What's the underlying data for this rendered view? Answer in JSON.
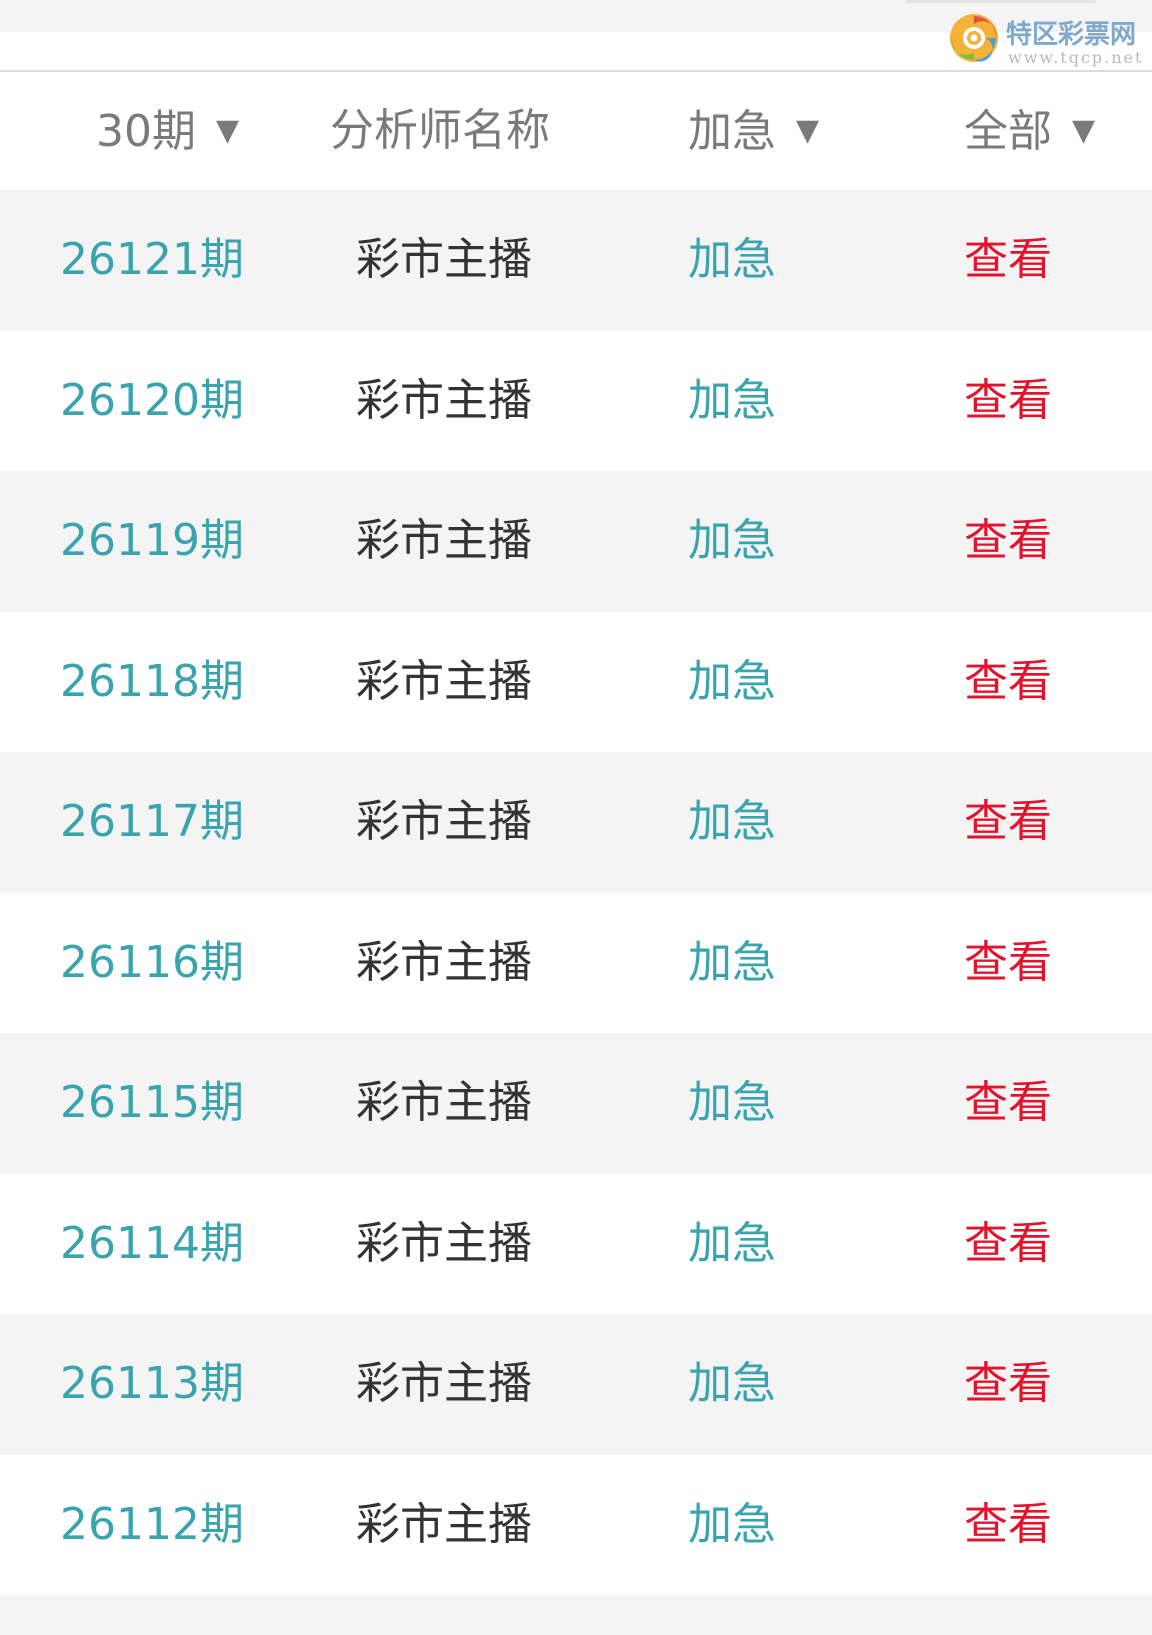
{
  "logo": {
    "name": "特区彩票网",
    "url": "www.tqcp.net",
    "icon": "swirl-logo-icon"
  },
  "header": {
    "period_filter": "30期",
    "analyst_name": "分析师名称",
    "urgent_filter": "加急",
    "type_filter": "全部",
    "dropdown_glyph": "▼"
  },
  "colors": {
    "issue": "#3aa4ae",
    "urgent": "#3aa4ae",
    "view": "#e2142d",
    "name": "#333333",
    "header_text": "#7a7a7a",
    "row_alt_bg": "#f4f4f4"
  },
  "rows": [
    {
      "issue": "26121期",
      "analyst": "彩市主播",
      "urgent": "加急",
      "action": "查看"
    },
    {
      "issue": "26120期",
      "analyst": "彩市主播",
      "urgent": "加急",
      "action": "查看"
    },
    {
      "issue": "26119期",
      "analyst": "彩市主播",
      "urgent": "加急",
      "action": "查看"
    },
    {
      "issue": "26118期",
      "analyst": "彩市主播",
      "urgent": "加急",
      "action": "查看"
    },
    {
      "issue": "26117期",
      "analyst": "彩市主播",
      "urgent": "加急",
      "action": "查看"
    },
    {
      "issue": "26116期",
      "analyst": "彩市主播",
      "urgent": "加急",
      "action": "查看"
    },
    {
      "issue": "26115期",
      "analyst": "彩市主播",
      "urgent": "加急",
      "action": "查看"
    },
    {
      "issue": "26114期",
      "analyst": "彩市主播",
      "urgent": "加急",
      "action": "查看"
    },
    {
      "issue": "26113期",
      "analyst": "彩市主播",
      "urgent": "加急",
      "action": "查看"
    },
    {
      "issue": "26112期",
      "analyst": "彩市主播",
      "urgent": "加急",
      "action": "查看"
    }
  ]
}
